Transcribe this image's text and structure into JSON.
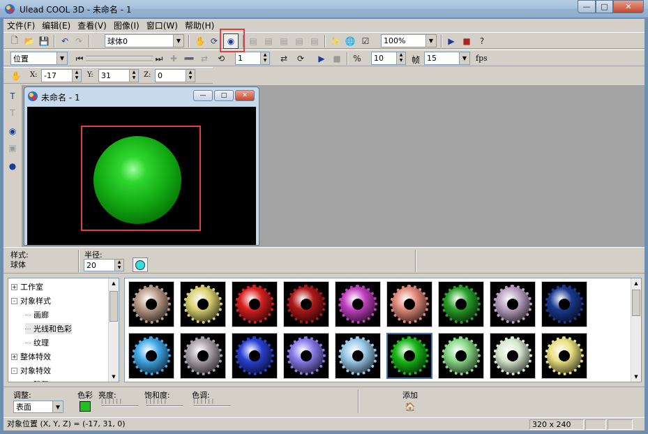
{
  "window": {
    "title": "Ulead COOL 3D - 未命名 - 1"
  },
  "menu": [
    "文件(F)",
    "编辑(E)",
    "查看(V)",
    "图像(I)",
    "窗口(W)",
    "帮助(H)"
  ],
  "toolbar1": {
    "object_select": "球体0",
    "zoom": "100%"
  },
  "toolbar2": {
    "property_select": "位置",
    "frame_value": "1",
    "frames_total": "10",
    "frame_label": "帧",
    "fps_value": "15",
    "fps_label": "fps"
  },
  "toolbar3": {
    "x_label": "X:",
    "x_value": "-17",
    "y_label": "Y:",
    "y_value": "31",
    "z_label": "Z:",
    "z_value": "0"
  },
  "document": {
    "title": "未命名 - 1"
  },
  "properties": {
    "style_label": "样式:",
    "style_value": "球体",
    "radius_label": "半径:",
    "radius_value": "20"
  },
  "tree": [
    {
      "label": "工作室",
      "expander": "+",
      "indent": 0
    },
    {
      "label": "对象样式",
      "expander": "-",
      "indent": 0
    },
    {
      "label": "画廊",
      "expander": "",
      "indent": 1
    },
    {
      "label": "光线和色彩",
      "expander": "",
      "indent": 1,
      "selected": true
    },
    {
      "label": "纹理",
      "expander": "",
      "indent": 1
    },
    {
      "label": "整体特效",
      "expander": "+",
      "indent": 0
    },
    {
      "label": "对象特效",
      "expander": "-",
      "indent": 0
    },
    {
      "label": "跳舞",
      "expander": "",
      "indent": 1
    }
  ],
  "thumbnails": [
    {
      "name": "gear-tan",
      "color": "#b89a88"
    },
    {
      "name": "gear-yellow",
      "color": "#d8d070"
    },
    {
      "name": "gear-red",
      "color": "#d82020"
    },
    {
      "name": "gear-darkred",
      "color": "#b01818"
    },
    {
      "name": "gear-magenta",
      "color": "#c040c0"
    },
    {
      "name": "gear-salmon",
      "color": "#e08878"
    },
    {
      "name": "gear-green",
      "color": "#28a028"
    },
    {
      "name": "gear-lilac",
      "color": "#b8a0c0"
    },
    {
      "name": "gear-navy",
      "color": "#1a3a90"
    },
    {
      "name": "gear-skyblue",
      "color": "#40a8e8"
    },
    {
      "name": "gear-grey",
      "color": "#a8a0a8"
    },
    {
      "name": "gear-blue",
      "color": "#2840d0"
    },
    {
      "name": "gear-periwinkle",
      "color": "#8878e8"
    },
    {
      "name": "gear-lightblue",
      "color": "#98c8e8"
    },
    {
      "name": "gear-brightgreen",
      "color": "#18b818",
      "selected": true
    },
    {
      "name": "gear-mint",
      "color": "#88d888"
    },
    {
      "name": "gear-pale",
      "color": "#d8e8d0"
    },
    {
      "name": "gear-paleyellow",
      "color": "#e8e080"
    }
  ],
  "adjust": {
    "label": "调整:",
    "select_value": "表面",
    "color_label": "色彩",
    "brightness_label": "亮度:",
    "saturation_label": "饱和度:",
    "hue_label": "色调:",
    "add_label": "添加",
    "swatch_color": "#20c020"
  },
  "status": {
    "position_text": "对象位置 (X, Y, Z) = (-17, 31, 0)",
    "size_text": "320 x 240"
  }
}
